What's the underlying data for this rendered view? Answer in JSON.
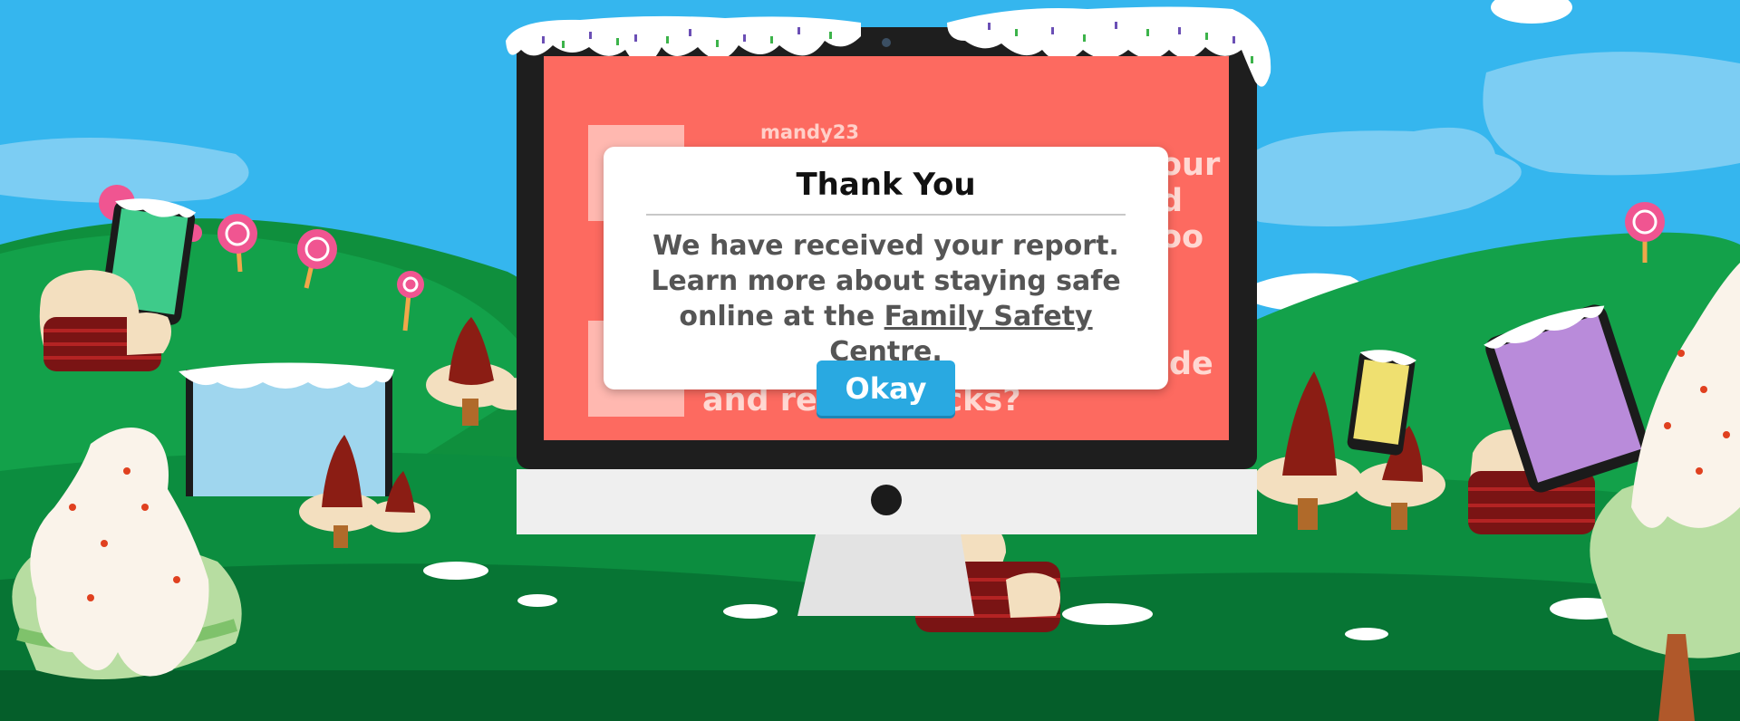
{
  "background_screen": {
    "username": "mandy23",
    "post_right_fragment": "our\nd\noo",
    "post_second_fragment": "de",
    "post_bottom_line": "and rec      sucks?"
  },
  "dialog": {
    "title": "Thank You",
    "body_text": "We have received your report. Learn more about staying safe online at the ",
    "link_text": "Family Safety Centre.",
    "button_label": "Okay"
  },
  "colors": {
    "sky": "#35b6ee",
    "grass": "#0fa046",
    "screen": "#fd6a60",
    "button": "#29a9e1"
  }
}
